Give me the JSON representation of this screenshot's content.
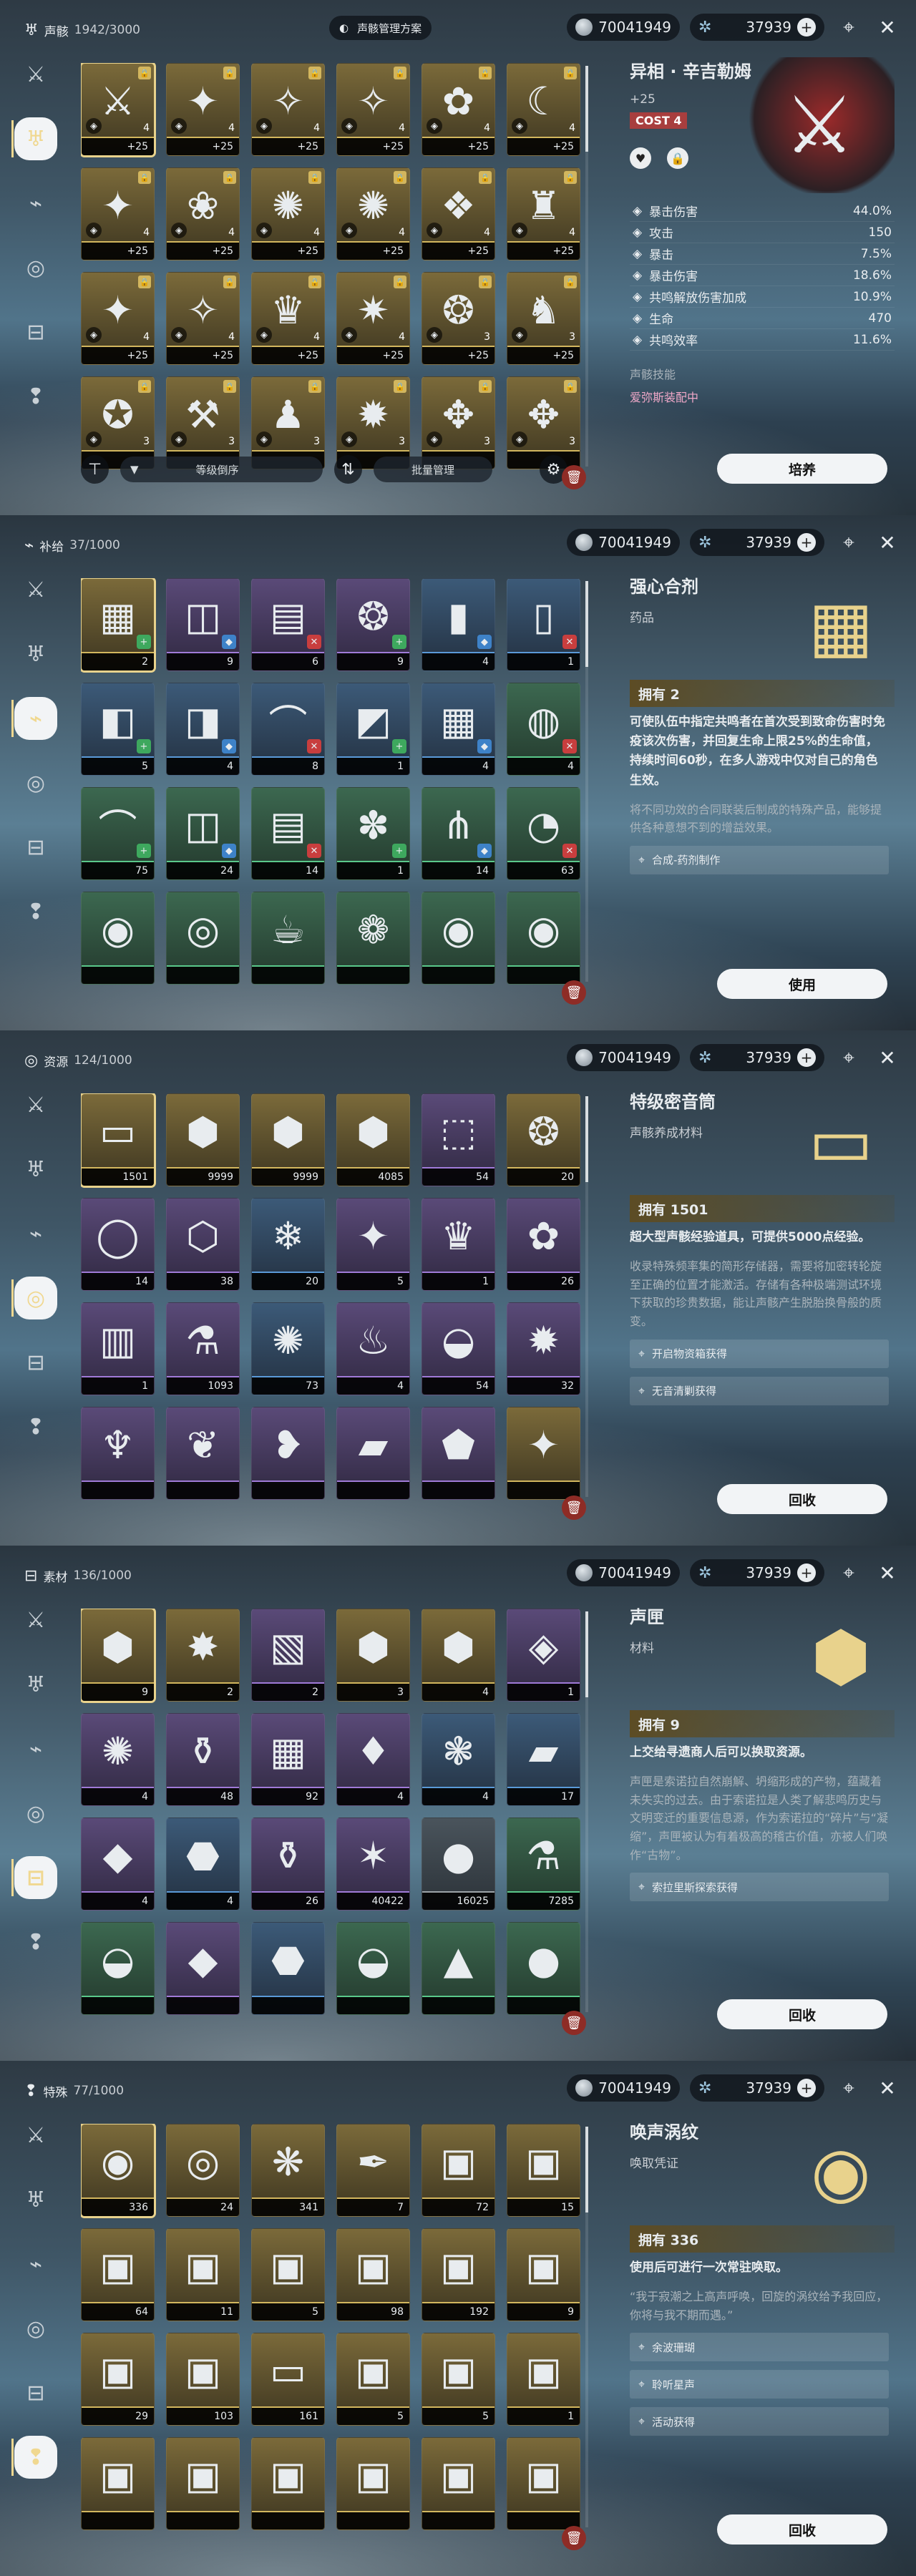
{
  "header": {
    "coins": "70041949",
    "stars": "37939",
    "scheme": "声骸管理方案"
  },
  "nav_icons": [
    "swords-icon",
    "echo-icon",
    "supply-icon",
    "resource-icon",
    "material-icon",
    "special-icon"
  ],
  "panels": [
    {
      "category": "声骸",
      "count": "1942/3000",
      "detail": {
        "title": "异相 · 辛吉勒姆",
        "level": "+25",
        "cost": "COST 4",
        "stats": [
          {
            "n": "暴击伤害",
            "v": "44.0%"
          },
          {
            "n": "攻击",
            "v": "150"
          },
          {
            "n": "暴击",
            "v": "7.5%"
          },
          {
            "n": "暴击伤害",
            "v": "18.6%"
          },
          {
            "n": "共鸣解放伤害加成",
            "v": "10.9%"
          },
          {
            "n": "生命",
            "v": "470"
          },
          {
            "n": "共鸣效率",
            "v": "11.6%"
          }
        ],
        "skill": "声骸技能",
        "equipped": "爱弥斯装配中"
      },
      "buttons": {
        "sort": "等级倒序",
        "batch": "批量管理",
        "action": "培养"
      },
      "items": [
        {
          "q": "+25",
          "lv": "4",
          "r": "r5",
          "art": "⚔",
          "sel": true
        },
        {
          "q": "+25",
          "lv": "4",
          "r": "r5",
          "art": "✦"
        },
        {
          "q": "+25",
          "lv": "4",
          "r": "r5",
          "art": "✧"
        },
        {
          "q": "+25",
          "lv": "4",
          "r": "r5",
          "art": "✧"
        },
        {
          "q": "+25",
          "lv": "4",
          "r": "r5",
          "art": "✿"
        },
        {
          "q": "+25",
          "lv": "4",
          "r": "r5",
          "art": "☾"
        },
        {
          "q": "+25",
          "lv": "4",
          "r": "r5",
          "art": "✦"
        },
        {
          "q": "+25",
          "lv": "4",
          "r": "r5",
          "art": "❀"
        },
        {
          "q": "+25",
          "lv": "4",
          "r": "r5",
          "art": "✺"
        },
        {
          "q": "+25",
          "lv": "4",
          "r": "r5",
          "art": "✺"
        },
        {
          "q": "+25",
          "lv": "4",
          "r": "r5",
          "art": "❖"
        },
        {
          "q": "+25",
          "lv": "4",
          "r": "r5",
          "art": "♜"
        },
        {
          "q": "+25",
          "lv": "4",
          "r": "r5",
          "art": "✦"
        },
        {
          "q": "+25",
          "lv": "4",
          "r": "r5",
          "art": "✧"
        },
        {
          "q": "+25",
          "lv": "4",
          "r": "r5",
          "art": "♛"
        },
        {
          "q": "+25",
          "lv": "4",
          "r": "r5",
          "art": "✷"
        },
        {
          "q": "+25",
          "lv": "3",
          "r": "r5",
          "art": "❂"
        },
        {
          "q": "+25",
          "lv": "3",
          "r": "r5",
          "art": "♞"
        },
        {
          "q": "",
          "lv": "3",
          "r": "r5",
          "art": "✪"
        },
        {
          "q": "",
          "lv": "3",
          "r": "r5",
          "art": "⚒"
        },
        {
          "q": "",
          "lv": "3",
          "r": "r5",
          "art": "♟"
        },
        {
          "q": "",
          "lv": "3",
          "r": "r5",
          "art": "✹"
        },
        {
          "q": "",
          "lv": "3",
          "r": "r5",
          "art": "✥"
        },
        {
          "q": "",
          "lv": "3",
          "r": "r5",
          "art": "✥"
        }
      ]
    },
    {
      "category": "补给",
      "count": "37/1000",
      "detail": {
        "title": "强心合剂",
        "sub": "药品",
        "own": "拥有 2",
        "main": "可使队伍中指定共鸣者在首次受到致命伤害时免疫该次伤害，并回复生命上限25%的生命值，持续时间60秒，在多人游戏中仅对自己的角色生效。",
        "desc": "将不同功效的合同联装后制成的特殊产品，能够提供各种意想不到的增益效果。",
        "sources": [
          "合成-药剂制作"
        ]
      },
      "buttons": {
        "action": "使用"
      },
      "items": [
        {
          "q": "2",
          "r": "r5",
          "art": "▦",
          "sel": true
        },
        {
          "q": "9",
          "r": "r4",
          "art": "◫"
        },
        {
          "q": "6",
          "r": "r4",
          "art": "▤"
        },
        {
          "q": "9",
          "r": "r4",
          "art": "❂"
        },
        {
          "q": "4",
          "r": "r3",
          "art": "▮"
        },
        {
          "q": "1",
          "r": "r3",
          "art": "▯"
        },
        {
          "q": "5",
          "r": "r3",
          "art": "◧"
        },
        {
          "q": "4",
          "r": "r3",
          "art": "◨"
        },
        {
          "q": "8",
          "r": "r3",
          "art": "⌒"
        },
        {
          "q": "1",
          "r": "r3",
          "art": "◩"
        },
        {
          "q": "4",
          "r": "r3",
          "art": "▦"
        },
        {
          "q": "4",
          "r": "r2",
          "art": "◍"
        },
        {
          "q": "75",
          "r": "r2",
          "art": "⌒"
        },
        {
          "q": "24",
          "r": "r2",
          "art": "◫"
        },
        {
          "q": "14",
          "r": "r2",
          "art": "▤"
        },
        {
          "q": "1",
          "r": "r2",
          "art": "✽"
        },
        {
          "q": "14",
          "r": "r2",
          "art": "⋔"
        },
        {
          "q": "63",
          "r": "r2",
          "art": "◔"
        },
        {
          "q": "",
          "r": "r2",
          "art": "◉"
        },
        {
          "q": "",
          "r": "r2",
          "art": "◎"
        },
        {
          "q": "",
          "r": "r2",
          "art": "☕"
        },
        {
          "q": "",
          "r": "r2",
          "art": "❁"
        },
        {
          "q": "",
          "r": "r2",
          "art": "◉"
        },
        {
          "q": "",
          "r": "r2",
          "art": "◉"
        }
      ]
    },
    {
      "category": "资源",
      "count": "124/1000",
      "detail": {
        "title": "特级密音筒",
        "sub": "声骸养成材料",
        "own": "拥有 1501",
        "main": "超大型声骸经验道具，可提供5000点经验。",
        "desc": "收录特殊频率集的简形存储器，需要将加密转轮旋至正确的位置才能激活。存储有各种极端测试环境下获取的珍贵数据，能让声骸产生脱胎换骨般的质变。",
        "sources": [
          "开启物资箱获得",
          "无音清剿获得"
        ]
      },
      "buttons": {
        "action": "回收"
      },
      "items": [
        {
          "q": "1501",
          "r": "r5",
          "art": "▭",
          "sel": true
        },
        {
          "q": "9999",
          "r": "r5",
          "art": "⬢"
        },
        {
          "q": "9999",
          "r": "r5",
          "art": "⬢"
        },
        {
          "q": "4085",
          "r": "r5",
          "art": "⬢"
        },
        {
          "q": "54",
          "r": "r4",
          "art": "⬚"
        },
        {
          "q": "20",
          "r": "r5",
          "art": "❂"
        },
        {
          "q": "14",
          "r": "r4",
          "art": "◯"
        },
        {
          "q": "38",
          "r": "r4",
          "art": "⬡"
        },
        {
          "q": "20",
          "r": "r3",
          "art": "❄"
        },
        {
          "q": "5",
          "r": "r4",
          "art": "✦"
        },
        {
          "q": "1",
          "r": "r4",
          "art": "♛"
        },
        {
          "q": "26",
          "r": "r4",
          "art": "✿"
        },
        {
          "q": "1",
          "r": "r4",
          "art": "▥"
        },
        {
          "q": "1093",
          "r": "r4",
          "art": "⚗"
        },
        {
          "q": "73",
          "r": "r3",
          "art": "✺"
        },
        {
          "q": "4",
          "r": "r4",
          "art": "♨"
        },
        {
          "q": "54",
          "r": "r4",
          "art": "◒"
        },
        {
          "q": "32",
          "r": "r4",
          "art": "✹"
        },
        {
          "q": "",
          "r": "r4",
          "art": "♆"
        },
        {
          "q": "",
          "r": "r4",
          "art": "❦"
        },
        {
          "q": "",
          "r": "r4",
          "art": "❥"
        },
        {
          "q": "",
          "r": "r4",
          "art": "▰"
        },
        {
          "q": "",
          "r": "r4",
          "art": "⬟"
        },
        {
          "q": "",
          "r": "r5",
          "art": "✦"
        }
      ]
    },
    {
      "category": "素材",
      "count": "136/1000",
      "detail": {
        "title": "声匣",
        "sub": "材料",
        "own": "拥有 9",
        "main": "上交给寻遗商人后可以换取资源。",
        "desc": "声匣是索诺拉自然崩解、坍缩形成的产物，蕴藏着未失实的过去。由于索诺拉是人类了解悲鸣历史与文明变迁的重要信息源，作为索诺拉的“碎片”与“凝缩”，声匣被认为有着极高的稽古价值，亦被人们唤作“古物”。",
        "sources": [
          "索拉里斯探索获得"
        ]
      },
      "buttons": {
        "action": "回收"
      },
      "items": [
        {
          "q": "9",
          "r": "r5",
          "art": "⬢",
          "sel": true
        },
        {
          "q": "2",
          "r": "r5",
          "art": "✸"
        },
        {
          "q": "2",
          "r": "r4",
          "art": "▧"
        },
        {
          "q": "3",
          "r": "r5",
          "art": "⬢"
        },
        {
          "q": "4",
          "r": "r5",
          "art": "⬢"
        },
        {
          "q": "1",
          "r": "r4",
          "art": "◈"
        },
        {
          "q": "4",
          "r": "r4",
          "art": "✺"
        },
        {
          "q": "48",
          "r": "r4",
          "art": "⚱"
        },
        {
          "q": "92",
          "r": "r4",
          "art": "▦"
        },
        {
          "q": "4",
          "r": "r4",
          "art": "♦"
        },
        {
          "q": "4",
          "r": "r3",
          "art": "❃"
        },
        {
          "q": "17",
          "r": "r3",
          "art": "▰"
        },
        {
          "q": "4",
          "r": "r4",
          "art": "◆"
        },
        {
          "q": "4",
          "r": "r3",
          "art": "⬣"
        },
        {
          "q": "26",
          "r": "r4",
          "art": "⚱"
        },
        {
          "q": "40422",
          "r": "r4",
          "art": "✶"
        },
        {
          "q": "16025",
          "r": "r1",
          "art": "●"
        },
        {
          "q": "7285",
          "r": "r2",
          "art": "⚗"
        },
        {
          "q": "",
          "r": "r2",
          "art": "◒"
        },
        {
          "q": "",
          "r": "r4",
          "art": "◆"
        },
        {
          "q": "",
          "r": "r3",
          "art": "⬣"
        },
        {
          "q": "",
          "r": "r2",
          "art": "◒"
        },
        {
          "q": "",
          "r": "r2",
          "art": "▲"
        },
        {
          "q": "",
          "r": "r2",
          "art": "●"
        }
      ]
    },
    {
      "category": "特殊",
      "count": "77/1000",
      "detail": {
        "title": "唤声涡纹",
        "sub": "唤取凭证",
        "own": "拥有 336",
        "main": "使用后可进行一次常驻唤取。",
        "desc": "“我于寂潮之上高声呼唤，回旋的涡纹给予我回应，你将与我不期而遇。”",
        "sources": [
          "余波珊瑚",
          "聆听星声",
          "活动获得"
        ]
      },
      "buttons": {
        "action": "回收"
      },
      "items": [
        {
          "q": "336",
          "r": "r5",
          "art": "◉",
          "sel": true
        },
        {
          "q": "24",
          "r": "r5",
          "art": "◎"
        },
        {
          "q": "341",
          "r": "r5",
          "art": "❋"
        },
        {
          "q": "7",
          "r": "r5",
          "art": "✒"
        },
        {
          "q": "72",
          "r": "r5",
          "art": "▣"
        },
        {
          "q": "15",
          "r": "r5",
          "art": "▣"
        },
        {
          "q": "64",
          "r": "r5",
          "art": "▣"
        },
        {
          "q": "11",
          "r": "r5",
          "art": "▣"
        },
        {
          "q": "5",
          "r": "r5",
          "art": "▣"
        },
        {
          "q": "98",
          "r": "r5",
          "art": "▣"
        },
        {
          "q": "192",
          "r": "r5",
          "art": "▣"
        },
        {
          "q": "9",
          "r": "r5",
          "art": "▣"
        },
        {
          "q": "29",
          "r": "r5",
          "art": "▣"
        },
        {
          "q": "103",
          "r": "r5",
          "art": "▣"
        },
        {
          "q": "161",
          "r": "r5",
          "art": "▭"
        },
        {
          "q": "5",
          "r": "r5",
          "art": "▣"
        },
        {
          "q": "5",
          "r": "r5",
          "art": "▣"
        },
        {
          "q": "1",
          "r": "r5",
          "art": "▣"
        },
        {
          "q": "",
          "r": "r5",
          "art": "▣"
        },
        {
          "q": "",
          "r": "r5",
          "art": "▣"
        },
        {
          "q": "",
          "r": "r5",
          "art": "▣"
        },
        {
          "q": "",
          "r": "r5",
          "art": "▣"
        },
        {
          "q": "",
          "r": "r5",
          "art": "▣"
        },
        {
          "q": "",
          "r": "r5",
          "art": "▣"
        }
      ]
    }
  ]
}
